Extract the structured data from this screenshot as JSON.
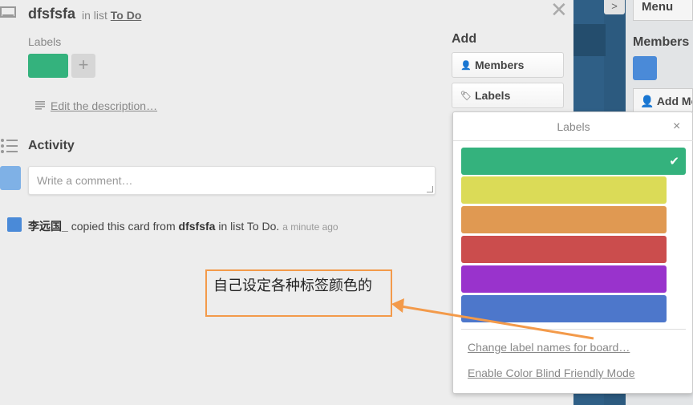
{
  "card": {
    "title": "dfsfsfa",
    "in_list_prefix": "in list",
    "list_name": "To Do",
    "labels_heading": "Labels",
    "label_chip_color": "#34b27d",
    "add_label_symbol": "+",
    "edit_description": "Edit the description…",
    "activity_heading": "Activity",
    "comment_placeholder": "Write a comment…",
    "activity_entry": {
      "user": "李远国_",
      "text": "copied this card from",
      "card": "dfsfsfa",
      "list_text": "in list To Do.",
      "time": "a minute ago"
    }
  },
  "add_section": {
    "heading": "Add",
    "members_button": "Members",
    "labels_button": "Labels"
  },
  "labels_popup": {
    "title": "Labels",
    "close_symbol": "×",
    "colors": [
      {
        "name": "green",
        "hex": "#34b27d",
        "selected": true
      },
      {
        "name": "yellow",
        "hex": "#dbdb57",
        "selected": false
      },
      {
        "name": "orange",
        "hex": "#e09952",
        "selected": false
      },
      {
        "name": "red",
        "hex": "#cb4d4d",
        "selected": false
      },
      {
        "name": "purple",
        "hex": "#9933cc",
        "selected": false
      },
      {
        "name": "blue",
        "hex": "#4d77cb",
        "selected": false
      }
    ],
    "check_symbol": "✔",
    "change_names_link": "Change label names for board…",
    "color_blind_link": "Enable Color Blind Friendly Mode"
  },
  "board_side": {
    "menu": "Menu",
    "members": "Members",
    "add_me": "Add Me",
    "tab_symbol": ">"
  },
  "annotation": {
    "text": "自己设定各种标签颜色的",
    "color": "#f39a4a"
  }
}
